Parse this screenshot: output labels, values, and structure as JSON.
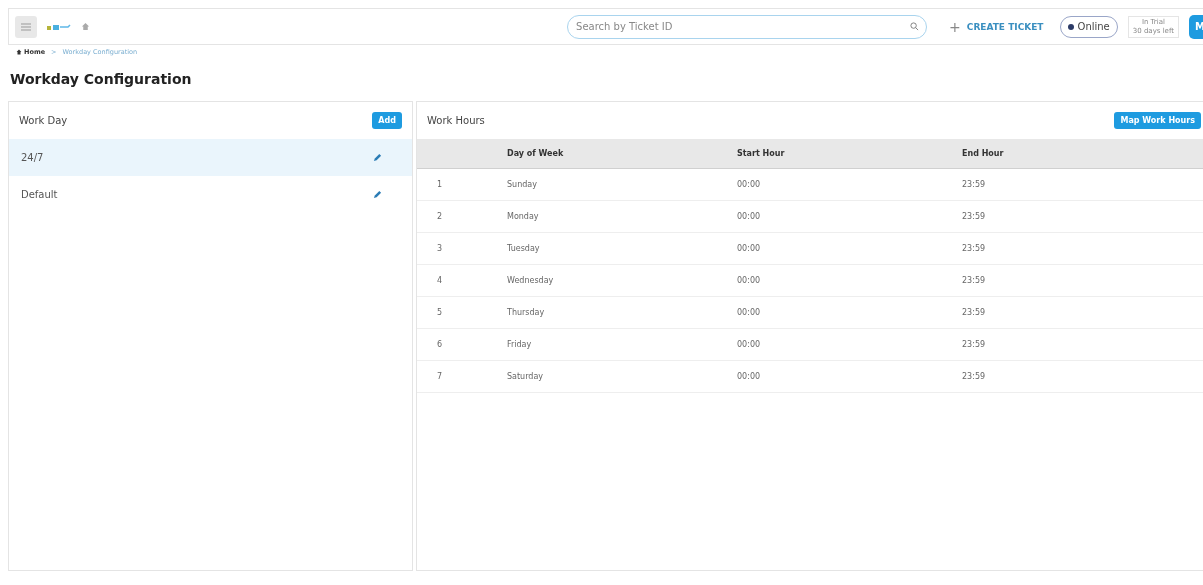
{
  "topbar": {
    "search": {
      "placeholder": "Search by Ticket ID"
    },
    "create_button": {
      "icon": "+",
      "label": "CREATE TICKET"
    },
    "status": {
      "label": "Online",
      "on": true
    },
    "trial": {
      "line_1": "In Trial",
      "line_2": "30 days left"
    },
    "avatar": "M"
  },
  "breadcrumb": [
    {
      "label": "Home",
      "selected": false
    },
    {
      "label": "Workday Configuration",
      "selected": true
    }
  ],
  "breadcrumb_separator": ">",
  "page_title": "Workday Configuration",
  "work_day": {
    "title": "Work Day",
    "add_button": "Add",
    "items": [
      {
        "label": "24/7",
        "selected": true
      },
      {
        "label": "Default",
        "selected": false
      }
    ]
  },
  "work_hours": {
    "title": "Work Hours",
    "map_button": "Map Work Hours",
    "table": {
      "columns": [
        "",
        "Day of Week",
        "Start Hour",
        "End Hour"
      ],
      "rows": [
        [
          "1",
          "Sunday",
          "00:00",
          "23:59"
        ],
        [
          "2",
          "Monday",
          "00:00",
          "23:59"
        ],
        [
          "3",
          "Tuesday",
          "00:00",
          "23:59"
        ],
        [
          "4",
          "Wednesday",
          "00:00",
          "23:59"
        ],
        [
          "5",
          "Thursday",
          "00:00",
          "23:59"
        ],
        [
          "6",
          "Friday",
          "00:00",
          "23:59"
        ],
        [
          "7",
          "Saturday",
          "00:00",
          "23:59"
        ]
      ]
    }
  }
}
